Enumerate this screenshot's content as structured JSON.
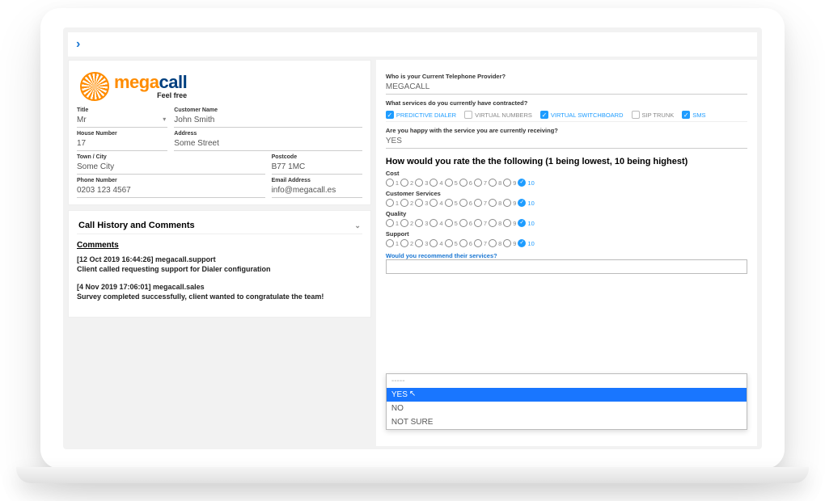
{
  "logo": {
    "mega": "mega",
    "call": "call",
    "tagline": "Feel free"
  },
  "customer": {
    "title_label": "Title",
    "title": "Mr",
    "name_label": "Customer Name",
    "name": "John Smith",
    "house_label": "House Number",
    "house": "17",
    "address_label": "Address",
    "address": "Some Street",
    "town_label": "Town / City",
    "town": "Some City",
    "postcode_label": "Postcode",
    "postcode": "B77 1MC",
    "phone_label": "Phone Number",
    "phone": "0203 123 4567",
    "email_label": "Email Address",
    "email": "info@megacall.es"
  },
  "history": {
    "heading": "Call History and Comments",
    "comments_heading": "Comments",
    "entries": [
      {
        "meta": "[12 Oct 2019 16:44:26] megacall.support",
        "body": "Client called requesting support for Dialer configuration"
      },
      {
        "meta": "[4 Nov 2019 17:06:01] megacall.sales",
        "body": "Survey completed successfully, client wanted to congratulate the team!"
      }
    ]
  },
  "survey": {
    "q_provider_label": "Who is your Current Telephone Provider?",
    "q_provider": "MEGACALL",
    "q_services_label": "What services do you currently have contracted?",
    "services": [
      {
        "label": "PREDICTIVE DIALER",
        "checked": true
      },
      {
        "label": "VIRTUAL NUMBERS",
        "checked": false
      },
      {
        "label": "VIRTUAL SWITCHBOARD",
        "checked": true
      },
      {
        "label": "SIP TRUNK",
        "checked": false
      },
      {
        "label": "SMS",
        "checked": true
      }
    ],
    "q_happy_label": "Are you happy with the service you are currently receiving?",
    "q_happy": "YES",
    "rate_heading": "How would you rate the the following (1 being lowest, 10 being highest)",
    "ratings": [
      {
        "label": "Cost",
        "value": 10
      },
      {
        "label": "Customer Services",
        "value": 10
      },
      {
        "label": "Quality",
        "value": 10
      },
      {
        "label": "Support",
        "value": 10
      }
    ],
    "q_recommend_label": "Would you recommend their services?",
    "dropdown": {
      "placeholder": "-----",
      "options": [
        "YES",
        "NO",
        "NOT SURE"
      ],
      "highlighted": "YES"
    }
  }
}
